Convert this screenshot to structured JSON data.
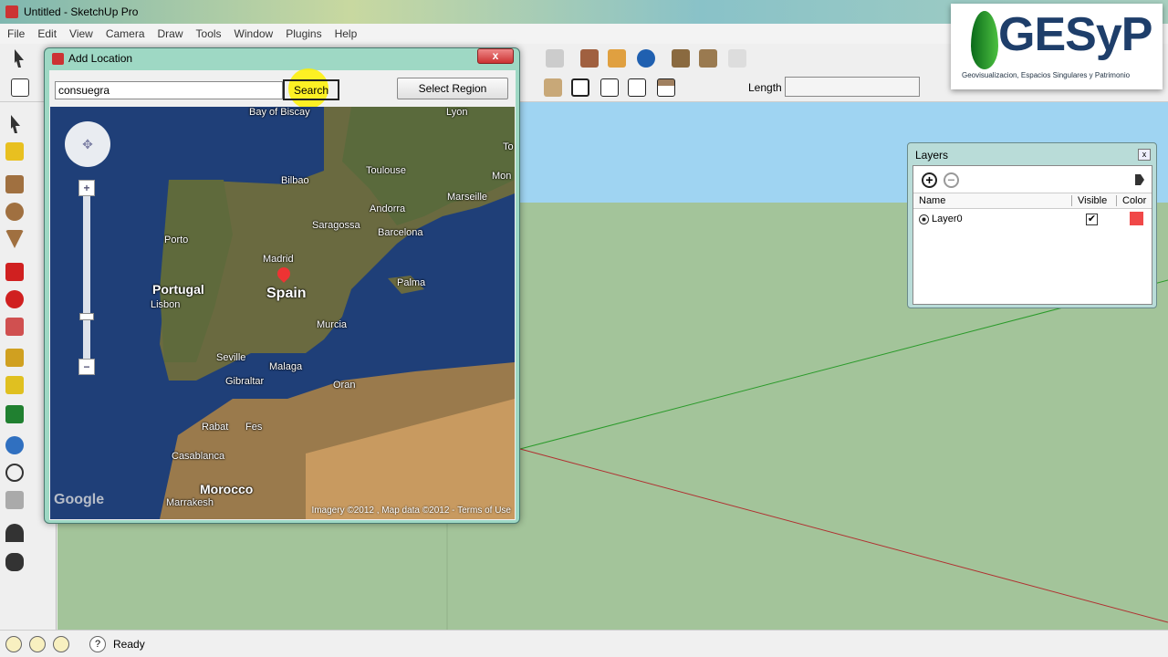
{
  "window": {
    "title": "Untitled - SketchUp Pro"
  },
  "menu": [
    "File",
    "Edit",
    "View",
    "Camera",
    "Draw",
    "Tools",
    "Window",
    "Plugins",
    "Help"
  ],
  "toolbar": {
    "length_label": "Length",
    "length_value": ""
  },
  "logo": {
    "name": "GESyP",
    "subtitle": "Geovisualizacion, Espacios Singulares y Patrimonio"
  },
  "layers": {
    "title": "Layers",
    "close": "x",
    "columns": [
      "Name",
      "Visible",
      "Color"
    ],
    "rows": [
      {
        "name": "Layer0",
        "visible": true,
        "color": "#f04848"
      }
    ]
  },
  "dialog": {
    "title": "Add Location",
    "close": "x",
    "search_value": "consuegra",
    "search_label": "Search",
    "select_region_label": "Select Region",
    "map": {
      "labels": {
        "bay": "Bay of Biscay",
        "lyon": "Lyon",
        "toulouse": "Toulouse",
        "bilbao": "Bilbao",
        "andorra": "Andorra",
        "marseille": "Marseille",
        "mon": "Mon",
        "to": "To",
        "saragossa": "Saragossa",
        "porto": "Porto",
        "barcelona": "Barcelona",
        "madrid": "Madrid",
        "spain": "Spain",
        "portugal": "Portugal",
        "lisbon": "Lisbon",
        "palma": "Palma",
        "murcia": "Murcia",
        "seville": "Seville",
        "malaga": "Malaga",
        "gibraltar": "Gibraltar",
        "oran": "Oran",
        "rabat": "Rabat",
        "fes": "Fes",
        "casablanca": "Casablanca",
        "morocco": "Morocco",
        "marrakesh": "Marrakesh"
      },
      "google": "Google",
      "copyright": "Imagery ©2012 , Map data ©2012 - Terms of Use"
    }
  },
  "status": {
    "text": "Ready",
    "help": "?"
  }
}
